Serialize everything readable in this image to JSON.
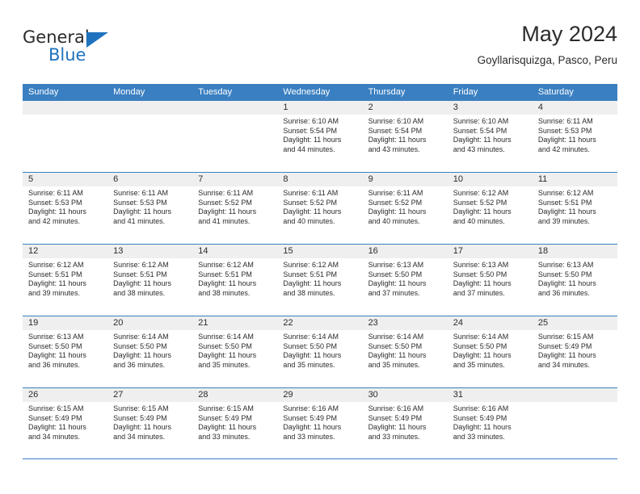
{
  "logo": {
    "primary_text": "General",
    "secondary_text": "Blue",
    "triangle_color": "#1f72bd",
    "primary_color": "#2b2b2b",
    "secondary_color": "#1f72bd"
  },
  "header": {
    "title": "May 2024",
    "subtitle": "Goyllarisquizga, Pasco, Peru"
  },
  "theme": {
    "header_blue": "#3a7fc1",
    "day_strip_gray": "#efefef",
    "text_color": "#2b2b2b"
  },
  "weekdays": [
    "Sunday",
    "Monday",
    "Tuesday",
    "Wednesday",
    "Thursday",
    "Friday",
    "Saturday"
  ],
  "weeks": [
    [
      {
        "day": "",
        "sunrise": "",
        "sunset": "",
        "daylight": "",
        "daylight2": ""
      },
      {
        "day": "",
        "sunrise": "",
        "sunset": "",
        "daylight": "",
        "daylight2": ""
      },
      {
        "day": "",
        "sunrise": "",
        "sunset": "",
        "daylight": "",
        "daylight2": ""
      },
      {
        "day": "1",
        "sunrise": "Sunrise: 6:10 AM",
        "sunset": "Sunset: 5:54 PM",
        "daylight": "Daylight: 11 hours",
        "daylight2": "and 44 minutes."
      },
      {
        "day": "2",
        "sunrise": "Sunrise: 6:10 AM",
        "sunset": "Sunset: 5:54 PM",
        "daylight": "Daylight: 11 hours",
        "daylight2": "and 43 minutes."
      },
      {
        "day": "3",
        "sunrise": "Sunrise: 6:10 AM",
        "sunset": "Sunset: 5:54 PM",
        "daylight": "Daylight: 11 hours",
        "daylight2": "and 43 minutes."
      },
      {
        "day": "4",
        "sunrise": "Sunrise: 6:11 AM",
        "sunset": "Sunset: 5:53 PM",
        "daylight": "Daylight: 11 hours",
        "daylight2": "and 42 minutes."
      }
    ],
    [
      {
        "day": "5",
        "sunrise": "Sunrise: 6:11 AM",
        "sunset": "Sunset: 5:53 PM",
        "daylight": "Daylight: 11 hours",
        "daylight2": "and 42 minutes."
      },
      {
        "day": "6",
        "sunrise": "Sunrise: 6:11 AM",
        "sunset": "Sunset: 5:53 PM",
        "daylight": "Daylight: 11 hours",
        "daylight2": "and 41 minutes."
      },
      {
        "day": "7",
        "sunrise": "Sunrise: 6:11 AM",
        "sunset": "Sunset: 5:52 PM",
        "daylight": "Daylight: 11 hours",
        "daylight2": "and 41 minutes."
      },
      {
        "day": "8",
        "sunrise": "Sunrise: 6:11 AM",
        "sunset": "Sunset: 5:52 PM",
        "daylight": "Daylight: 11 hours",
        "daylight2": "and 40 minutes."
      },
      {
        "day": "9",
        "sunrise": "Sunrise: 6:11 AM",
        "sunset": "Sunset: 5:52 PM",
        "daylight": "Daylight: 11 hours",
        "daylight2": "and 40 minutes."
      },
      {
        "day": "10",
        "sunrise": "Sunrise: 6:12 AM",
        "sunset": "Sunset: 5:52 PM",
        "daylight": "Daylight: 11 hours",
        "daylight2": "and 40 minutes."
      },
      {
        "day": "11",
        "sunrise": "Sunrise: 6:12 AM",
        "sunset": "Sunset: 5:51 PM",
        "daylight": "Daylight: 11 hours",
        "daylight2": "and 39 minutes."
      }
    ],
    [
      {
        "day": "12",
        "sunrise": "Sunrise: 6:12 AM",
        "sunset": "Sunset: 5:51 PM",
        "daylight": "Daylight: 11 hours",
        "daylight2": "and 39 minutes."
      },
      {
        "day": "13",
        "sunrise": "Sunrise: 6:12 AM",
        "sunset": "Sunset: 5:51 PM",
        "daylight": "Daylight: 11 hours",
        "daylight2": "and 38 minutes."
      },
      {
        "day": "14",
        "sunrise": "Sunrise: 6:12 AM",
        "sunset": "Sunset: 5:51 PM",
        "daylight": "Daylight: 11 hours",
        "daylight2": "and 38 minutes."
      },
      {
        "day": "15",
        "sunrise": "Sunrise: 6:12 AM",
        "sunset": "Sunset: 5:51 PM",
        "daylight": "Daylight: 11 hours",
        "daylight2": "and 38 minutes."
      },
      {
        "day": "16",
        "sunrise": "Sunrise: 6:13 AM",
        "sunset": "Sunset: 5:50 PM",
        "daylight": "Daylight: 11 hours",
        "daylight2": "and 37 minutes."
      },
      {
        "day": "17",
        "sunrise": "Sunrise: 6:13 AM",
        "sunset": "Sunset: 5:50 PM",
        "daylight": "Daylight: 11 hours",
        "daylight2": "and 37 minutes."
      },
      {
        "day": "18",
        "sunrise": "Sunrise: 6:13 AM",
        "sunset": "Sunset: 5:50 PM",
        "daylight": "Daylight: 11 hours",
        "daylight2": "and 36 minutes."
      }
    ],
    [
      {
        "day": "19",
        "sunrise": "Sunrise: 6:13 AM",
        "sunset": "Sunset: 5:50 PM",
        "daylight": "Daylight: 11 hours",
        "daylight2": "and 36 minutes."
      },
      {
        "day": "20",
        "sunrise": "Sunrise: 6:14 AM",
        "sunset": "Sunset: 5:50 PM",
        "daylight": "Daylight: 11 hours",
        "daylight2": "and 36 minutes."
      },
      {
        "day": "21",
        "sunrise": "Sunrise: 6:14 AM",
        "sunset": "Sunset: 5:50 PM",
        "daylight": "Daylight: 11 hours",
        "daylight2": "and 35 minutes."
      },
      {
        "day": "22",
        "sunrise": "Sunrise: 6:14 AM",
        "sunset": "Sunset: 5:50 PM",
        "daylight": "Daylight: 11 hours",
        "daylight2": "and 35 minutes."
      },
      {
        "day": "23",
        "sunrise": "Sunrise: 6:14 AM",
        "sunset": "Sunset: 5:50 PM",
        "daylight": "Daylight: 11 hours",
        "daylight2": "and 35 minutes."
      },
      {
        "day": "24",
        "sunrise": "Sunrise: 6:14 AM",
        "sunset": "Sunset: 5:50 PM",
        "daylight": "Daylight: 11 hours",
        "daylight2": "and 35 minutes."
      },
      {
        "day": "25",
        "sunrise": "Sunrise: 6:15 AM",
        "sunset": "Sunset: 5:49 PM",
        "daylight": "Daylight: 11 hours",
        "daylight2": "and 34 minutes."
      }
    ],
    [
      {
        "day": "26",
        "sunrise": "Sunrise: 6:15 AM",
        "sunset": "Sunset: 5:49 PM",
        "daylight": "Daylight: 11 hours",
        "daylight2": "and 34 minutes."
      },
      {
        "day": "27",
        "sunrise": "Sunrise: 6:15 AM",
        "sunset": "Sunset: 5:49 PM",
        "daylight": "Daylight: 11 hours",
        "daylight2": "and 34 minutes."
      },
      {
        "day": "28",
        "sunrise": "Sunrise: 6:15 AM",
        "sunset": "Sunset: 5:49 PM",
        "daylight": "Daylight: 11 hours",
        "daylight2": "and 33 minutes."
      },
      {
        "day": "29",
        "sunrise": "Sunrise: 6:16 AM",
        "sunset": "Sunset: 5:49 PM",
        "daylight": "Daylight: 11 hours",
        "daylight2": "and 33 minutes."
      },
      {
        "day": "30",
        "sunrise": "Sunrise: 6:16 AM",
        "sunset": "Sunset: 5:49 PM",
        "daylight": "Daylight: 11 hours",
        "daylight2": "and 33 minutes."
      },
      {
        "day": "31",
        "sunrise": "Sunrise: 6:16 AM",
        "sunset": "Sunset: 5:49 PM",
        "daylight": "Daylight: 11 hours",
        "daylight2": "and 33 minutes."
      },
      {
        "day": "",
        "sunrise": "",
        "sunset": "",
        "daylight": "",
        "daylight2": ""
      }
    ]
  ]
}
